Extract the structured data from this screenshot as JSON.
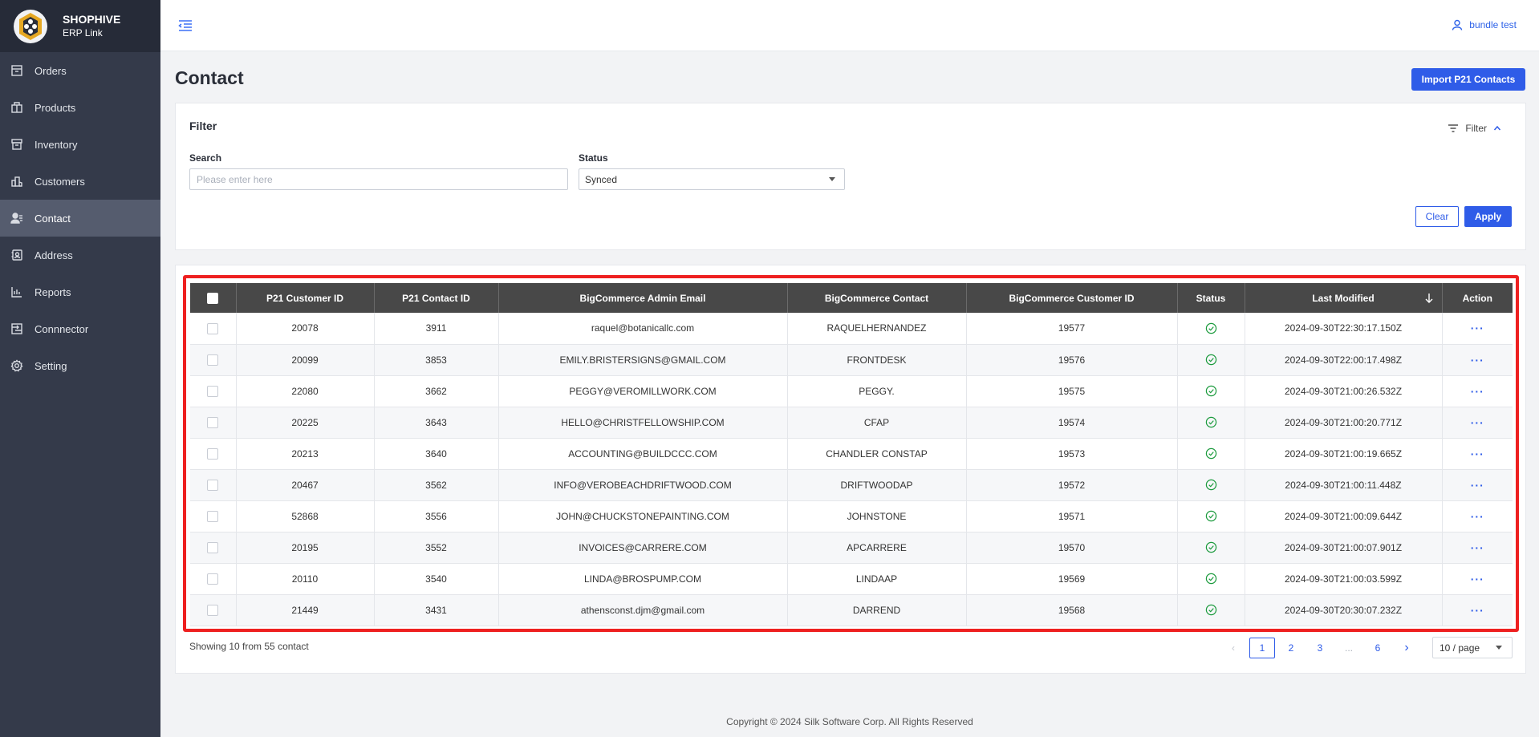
{
  "brand": {
    "name": "SHOPHIVE",
    "subtitle": "ERP Link"
  },
  "sidebar": {
    "items": [
      {
        "label": "Orders",
        "icon": "orders-icon",
        "active": false
      },
      {
        "label": "Products",
        "icon": "products-icon",
        "active": false
      },
      {
        "label": "Inventory",
        "icon": "inventory-icon",
        "active": false
      },
      {
        "label": "Customers",
        "icon": "customers-icon",
        "active": false
      },
      {
        "label": "Contact",
        "icon": "contact-icon",
        "active": true
      },
      {
        "label": "Address",
        "icon": "address-icon",
        "active": false
      },
      {
        "label": "Reports",
        "icon": "reports-icon",
        "active": false
      },
      {
        "label": "Connnector",
        "icon": "connector-icon",
        "active": false
      },
      {
        "label": "Setting",
        "icon": "setting-icon",
        "active": false
      }
    ]
  },
  "header": {
    "user": "bundle test"
  },
  "page": {
    "title": "Contact",
    "import_button": "Import P21 Contacts"
  },
  "filter": {
    "title": "Filter",
    "toggle_label": "Filter",
    "search_label": "Search",
    "search_placeholder": "Please enter here",
    "search_value": "",
    "status_label": "Status",
    "status_value": "Synced",
    "clear_label": "Clear",
    "apply_label": "Apply"
  },
  "table": {
    "columns": [
      "P21 Customer ID",
      "P21 Contact ID",
      "BigCommerce Admin Email",
      "BigCommerce Contact",
      "BigCommerce Customer ID",
      "Status",
      "Last Modified",
      "Action"
    ],
    "rows": [
      {
        "customer_id": "20078",
        "contact_id": "3911",
        "email": "raquel@botanicallc.com",
        "contact": "RAQUELHERNANDEZ",
        "bc_customer_id": "19577",
        "status": "synced",
        "modified": "2024-09-30T22:30:17.150Z"
      },
      {
        "customer_id": "20099",
        "contact_id": "3853",
        "email": "EMILY.BRISTERSIGNS@GMAIL.COM",
        "contact": "FRONTDESK",
        "bc_customer_id": "19576",
        "status": "synced",
        "modified": "2024-09-30T22:00:17.498Z"
      },
      {
        "customer_id": "22080",
        "contact_id": "3662",
        "email": "PEGGY@VEROMILLWORK.COM",
        "contact": "PEGGY.",
        "bc_customer_id": "19575",
        "status": "synced",
        "modified": "2024-09-30T21:00:26.532Z"
      },
      {
        "customer_id": "20225",
        "contact_id": "3643",
        "email": "HELLO@CHRISTFELLOWSHIP.COM",
        "contact": "CFAP",
        "bc_customer_id": "19574",
        "status": "synced",
        "modified": "2024-09-30T21:00:20.771Z"
      },
      {
        "customer_id": "20213",
        "contact_id": "3640",
        "email": "ACCOUNTING@BUILDCCC.COM",
        "contact": "CHANDLER CONSTAP",
        "bc_customer_id": "19573",
        "status": "synced",
        "modified": "2024-09-30T21:00:19.665Z"
      },
      {
        "customer_id": "20467",
        "contact_id": "3562",
        "email": "INFO@VEROBEACHDRIFTWOOD.COM",
        "contact": "DRIFTWOODAP",
        "bc_customer_id": "19572",
        "status": "synced",
        "modified": "2024-09-30T21:00:11.448Z"
      },
      {
        "customer_id": "52868",
        "contact_id": "3556",
        "email": "JOHN@CHUCKSTONEPAINTING.COM",
        "contact": "JOHNSTONE",
        "bc_customer_id": "19571",
        "status": "synced",
        "modified": "2024-09-30T21:00:09.644Z"
      },
      {
        "customer_id": "20195",
        "contact_id": "3552",
        "email": "INVOICES@CARRERE.COM",
        "contact": "APCARRERE",
        "bc_customer_id": "19570",
        "status": "synced",
        "modified": "2024-09-30T21:00:07.901Z"
      },
      {
        "customer_id": "20110",
        "contact_id": "3540",
        "email": "LINDA@BROSPUMP.COM",
        "contact": "LINDAAP",
        "bc_customer_id": "19569",
        "status": "synced",
        "modified": "2024-09-30T21:00:03.599Z"
      },
      {
        "customer_id": "21449",
        "contact_id": "3431",
        "email": "athensconst.djm@gmail.com",
        "contact": "DARREND",
        "bc_customer_id": "19568",
        "status": "synced",
        "modified": "2024-09-30T20:30:07.232Z"
      }
    ],
    "action_glyph": "···"
  },
  "pagination": {
    "summary": "Showing 10 from 55 contact",
    "pages": [
      "1",
      "2",
      "3",
      "...",
      "6"
    ],
    "current": "1",
    "page_size": "10 / page"
  },
  "footer": {
    "copyright": "Copyright © 2024 Silk Software Corp. All Rights Reserved"
  },
  "colors": {
    "accent": "#2f5ce8",
    "sidebar": "#343a4a",
    "table_header": "#484848",
    "status_ok": "#1a9a3c",
    "highlight": "#ee2020"
  }
}
